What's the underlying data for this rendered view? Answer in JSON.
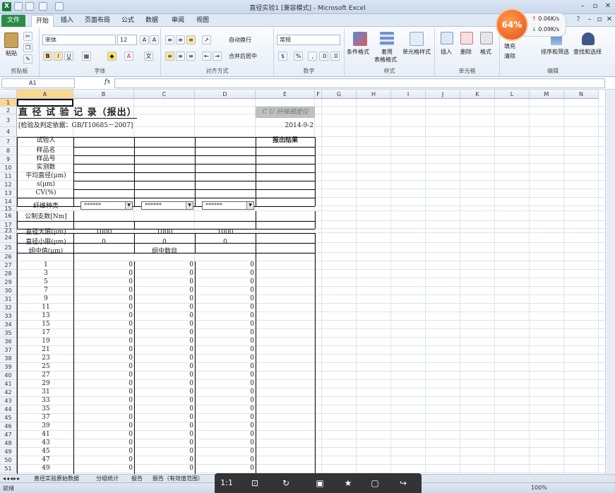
{
  "window": {
    "title": "直径实验1 [兼容模式] - Microsoft Excel",
    "logo": "X"
  },
  "tabs": [
    {
      "label": "文件"
    },
    {
      "label": "开始"
    },
    {
      "label": "插入"
    },
    {
      "label": "页面布局"
    },
    {
      "label": "公式"
    },
    {
      "label": "数据"
    },
    {
      "label": "审阅"
    },
    {
      "label": "视图"
    }
  ],
  "ribbon": {
    "clipboard": {
      "label": "剪贴板",
      "paste": "粘贴"
    },
    "font": {
      "label": "字体",
      "name": "宋体",
      "size": "12",
      "bold": "B",
      "italic": "I",
      "underline": "U"
    },
    "alignment": {
      "label": "对齐方式",
      "wrap": "自动换行",
      "merge": "合并后居中"
    },
    "number": {
      "label": "数字",
      "format": "常规",
      "currency": "$",
      "percent": "%"
    },
    "styles": {
      "label": "样式",
      "cond": "条件格式",
      "table_line1": "套用",
      "table_line2": "表格格式",
      "cell": "单元格样式"
    },
    "cells": {
      "label": "单元格",
      "insert": "插入",
      "delete": "删除",
      "format": "格式"
    },
    "editing": {
      "label": "编辑",
      "fill": "填充",
      "clear": "清除",
      "sort": "排序和筛选",
      "find": "查找和选择"
    }
  },
  "speed": {
    "percent": "64%",
    "up": "0.06K/s",
    "down": "0.09K/s"
  },
  "formula_bar": {
    "namebox": "A1",
    "fx": "fx"
  },
  "columns": [
    "A",
    "B",
    "C",
    "D",
    "E",
    "F",
    "G",
    "H",
    "I",
    "J",
    "K",
    "L",
    "M",
    "N"
  ],
  "rows": [
    "1",
    "2",
    "3",
    "4",
    "7",
    "8",
    "9",
    "10",
    "11",
    "12",
    "13",
    "14",
    "15",
    "16",
    "17",
    "23",
    "24",
    "25",
    "26",
    "27",
    "28",
    "29",
    "30",
    "31",
    "32",
    "33",
    "34",
    "35",
    "36",
    "37",
    "38",
    "39",
    "40",
    "41",
    "42",
    "43",
    "44",
    "45",
    "46",
    "47",
    "48",
    "49",
    "50",
    "51"
  ],
  "sheet": {
    "title": "直 径 试 验 记 录（报出）",
    "instrument": "C U 纤维细度仪",
    "basis": "[检验及判定依据：GB/T10685－2007]",
    "date": "2014-9-2",
    "report_result": "报出结果",
    "labels": [
      "试验人",
      "样品名",
      "样品号",
      "实测数",
      "平均直径(μm)",
      "s(μm)",
      "CV(%)"
    ],
    "fiber_type": "纤维种类",
    "dropdowns": [
      "******",
      "******",
      "******"
    ],
    "count_label": "公制支数[Nm]",
    "max_label": "直径大限(μm)",
    "min_label": "直径小限(μm)",
    "max_values": [
      "1000",
      "1000",
      "1000"
    ],
    "min_values": [
      "0",
      "0",
      "0"
    ],
    "group_label": "组中值(μm)",
    "group_count": "组中数目",
    "group_values": [
      "1",
      "3",
      "5",
      "7",
      "9",
      "11",
      "13",
      "15",
      "17",
      "19",
      "21",
      "23",
      "25",
      "27",
      "29",
      "31",
      "33",
      "35",
      "37",
      "39",
      "41",
      "43",
      "45",
      "47",
      "49"
    ],
    "zero": "0"
  },
  "sheet_tabs": [
    "直径实验原始数据",
    "分组统计",
    "报告",
    "报告（有效值范围）"
  ],
  "status": {
    "ready": "就绪",
    "zoom": "100%"
  }
}
